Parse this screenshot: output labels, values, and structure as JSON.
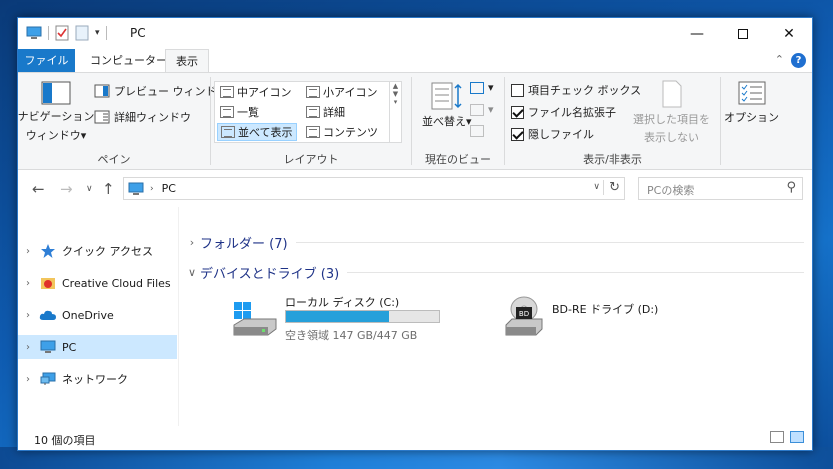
{
  "window": {
    "title": "PC"
  },
  "tabs": {
    "file": "ファイル",
    "computer": "コンピューター",
    "view": "表示"
  },
  "ribbon": {
    "pane": {
      "nav_pane_line1": "ナビゲーション",
      "nav_pane_line2": "ウィンドウ",
      "preview_pane": "プレビュー ウィンドウ",
      "details_pane": "詳細ウィンドウ",
      "group_name": "ペイン"
    },
    "layout": {
      "items": [
        "中アイコン",
        "小アイコン",
        "一覧",
        "詳細",
        "並べて表示",
        "コンテンツ"
      ],
      "selected": "並べて表示",
      "group_name": "レイアウト"
    },
    "current_view": {
      "sort_by": "並べ替え",
      "group_name": "現在のビュー"
    },
    "show_hide": {
      "item_check_boxes": "項目チェック ボックス",
      "file_name_extensions": "ファイル名拡張子",
      "hidden_items": "隠しファイル",
      "hide_selected_line1": "選択した項目を",
      "hide_selected_line2": "表示しない",
      "group_name": "表示/非表示",
      "checked": {
        "item_check_boxes": false,
        "file_name_extensions": true,
        "hidden_items": true
      }
    },
    "options": "オプション"
  },
  "address": {
    "crumb": "PC",
    "search_placeholder": "PCの検索"
  },
  "nav": [
    {
      "label": "クイック アクセス",
      "icon": "star-icon"
    },
    {
      "label": "Creative Cloud Files",
      "icon": "creative-cloud-folder-icon"
    },
    {
      "label": "OneDrive",
      "icon": "cloud-icon"
    },
    {
      "label": "PC",
      "icon": "computer-icon",
      "selected": true
    },
    {
      "label": "ネットワーク",
      "icon": "network-icon"
    }
  ],
  "content": {
    "folders_header": "フォルダー (7)",
    "devices_header": "デバイスとドライブ (3)",
    "drives": [
      {
        "name": "ローカル ディスク (C:)",
        "free_text": "空き領域 147 GB/447 GB",
        "used_fraction": 0.671
      },
      {
        "name": "BD-RE ドライブ (D:)"
      }
    ]
  },
  "status": {
    "count": "10 個の項目"
  },
  "colors": {
    "accent": "#1979ca",
    "selection": "#cce8ff",
    "progress": "#26a0da"
  }
}
